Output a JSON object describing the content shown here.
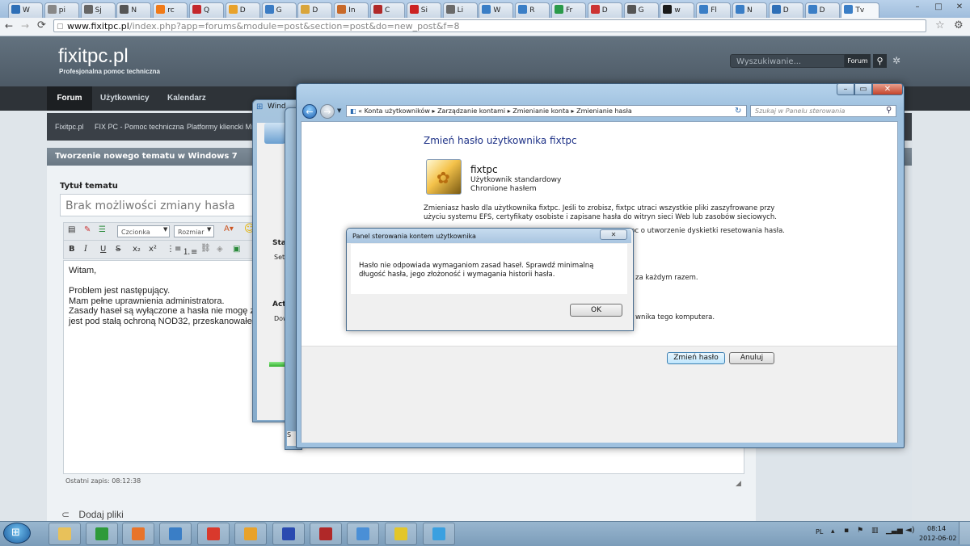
{
  "browser": {
    "tabs": [
      {
        "label": "W",
        "color": "#2e6fb7"
      },
      {
        "label": "pi",
        "color": "#888888"
      },
      {
        "label": "Sj",
        "color": "#666666"
      },
      {
        "label": "N",
        "color": "#555555"
      },
      {
        "label": "rc",
        "color": "#f07a18"
      },
      {
        "label": "Q",
        "color": "#c4272c"
      },
      {
        "label": "D",
        "color": "#e8a22b"
      },
      {
        "label": "G",
        "color": "#3b7cc4"
      },
      {
        "label": "D",
        "color": "#d9a53b"
      },
      {
        "label": "In",
        "color": "#c86a2a"
      },
      {
        "label": "C",
        "color": "#b02828"
      },
      {
        "label": "Si",
        "color": "#c22"
      },
      {
        "label": "Li",
        "color": "#6a6a6a"
      },
      {
        "label": "W",
        "color": "#3a7ec6"
      },
      {
        "label": "R",
        "color": "#3a7ec6"
      },
      {
        "label": "Fr",
        "color": "#2a9a4a"
      },
      {
        "label": "D",
        "color": "#c33"
      },
      {
        "label": "G",
        "color": "#555"
      },
      {
        "label": "w",
        "color": "#1a1a1a"
      },
      {
        "label": "Fl",
        "color": "#3a7ec6"
      },
      {
        "label": "N",
        "color": "#3a7ec6"
      },
      {
        "label": "D",
        "color": "#2e6fb7"
      },
      {
        "label": "D",
        "color": "#3a7ec6"
      },
      {
        "label": "Tv",
        "color": "#3a7ec6"
      }
    ],
    "url_domain": "www.fixitpc.pl",
    "url_path": "/index.php?app=forums&module=post&section=post&do=new_post&f=8"
  },
  "site": {
    "logo": "fixitpc.pl",
    "tagline": "Profesjonalna pomoc techniczna",
    "search_placeholder": "Wyszukiwanie...",
    "search_scope": "Forum",
    "nav": [
      "Forum",
      "Użytkownicy",
      "Kalendarz"
    ],
    "breadcrumbs": [
      "Fixitpc.pl",
      "FIX PC - Pomoc techniczna",
      "Platformy kliencki Mic"
    ],
    "panel_title": "Tworzenie nowego tematu w Windows 7",
    "topic_label": "Tytuł tematu",
    "topic_value": "Brak możliwości zmiany hasła",
    "font_combo": "Czcionka",
    "size_combo": "Rozmiar",
    "post_lines": [
      "Witam,",
      "",
      "Problem jest następujący.",
      "Mam pełne uprawnienia administratora.",
      "Zasady haseł są wyłączone a hasła nie mogę zmi",
      "jest pod stałą ochroną NOD32, przeskanowałem"
    ],
    "autosave": "Ostatni zapis: 08:12:38",
    "attach": "Dodaj pliki"
  },
  "bg_windows": {
    "title_fragment": "Wind",
    "status_label": "Stat",
    "setup_label": "Setu",
    "activity_label": "Acti",
    "download_label": "Dow"
  },
  "control_panel": {
    "breadcrumbs": [
      "Konta użytkowników",
      "Zarządzanie kontami",
      "Zmienianie konta",
      "Zmienianie hasła"
    ],
    "search_placeholder": "Szukaj w Panelu sterowania",
    "heading": "Zmień hasło użytkownika fixtpc",
    "user_name": "fixtpc",
    "user_type": "Użytkownik standardowy",
    "user_pass": "Chronione hasłem",
    "warning": "Zmieniasz hasło dla użytkownika fixtpc. Jeśli to zrobisz, fixtpc utraci wszystkie pliki zaszyfrowane przy użyciu systemu EFS, certyfikaty osobiste i zapisane hasła do witryn sieci Web lub zasobów sieciowych.",
    "obscured1": "pc o utworzenie dyskietki resetowania hasła.",
    "obscured2": "za każdym razem.",
    "obscured3": "wnika tego komputera.",
    "btn_change": "Zmień hasło",
    "btn_cancel": "Anuluj"
  },
  "dialog": {
    "title": "Panel sterowania kontem użytkownika",
    "message": "Hasło nie odpowiada wymaganiom zasad haseł. Sprawdź minimalną długość hasła, jego złożoność i wymagania historii hasła.",
    "ok": "OK"
  },
  "taskbar": {
    "icons": [
      {
        "name": "explorer-icon",
        "color": "#e8c15a"
      },
      {
        "name": "perfmon-icon",
        "color": "#2e9a3a"
      },
      {
        "name": "media-player-icon",
        "color": "#e8742a"
      },
      {
        "name": "network-icon",
        "color": "#3a7ec6"
      },
      {
        "name": "chrome-icon",
        "color": "#d9392c"
      },
      {
        "name": "outlook-icon",
        "color": "#e8a22b"
      },
      {
        "name": "save-disk-icon",
        "color": "#2a4ab0"
      },
      {
        "name": "gmail-icon",
        "color": "#b02828"
      },
      {
        "name": "control-panel-icon",
        "color": "#4a8fd6"
      },
      {
        "name": "app-icon",
        "color": "#e3c62a"
      },
      {
        "name": "windows-icon",
        "color": "#3aa0e0"
      }
    ],
    "lang": "PL",
    "time": "08:14",
    "date": "2012-06-02"
  }
}
